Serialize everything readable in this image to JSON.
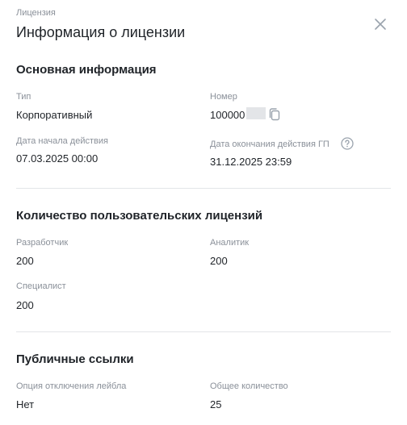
{
  "header": {
    "eyebrow": "Лицензия",
    "title": "Информация о лицензии"
  },
  "sections": {
    "basic": {
      "title": "Основная информация",
      "type_label": "Тип",
      "type_value": "Корпоративный",
      "number_label": "Номер",
      "number_value": "100000",
      "start_label": "Дата начала действия",
      "start_value": "07.03.2025 00:00",
      "end_label": "Дата окончания действия ГП",
      "end_value": "31.12.2025 23:59"
    },
    "licenses": {
      "title": "Количество пользовательских лицензий",
      "developer_label": "Разработчик",
      "developer_value": "200",
      "analyst_label": "Аналитик",
      "analyst_value": "200",
      "specialist_label": "Специалист",
      "specialist_value": "200"
    },
    "public_links": {
      "title": "Публичные ссылки",
      "label_option_label": "Опция отключения лейбла",
      "label_option_value": "Нет",
      "total_label": "Общее количество",
      "total_value": "25"
    }
  },
  "icons": {
    "close": "close-icon",
    "copy": "copy-icon",
    "help": "help-circle-icon"
  },
  "colors": {
    "muted_text": "#8a9099",
    "primary_text": "#1f2328",
    "divider": "#e3e5e8",
    "icon": "#9aa3ad"
  }
}
